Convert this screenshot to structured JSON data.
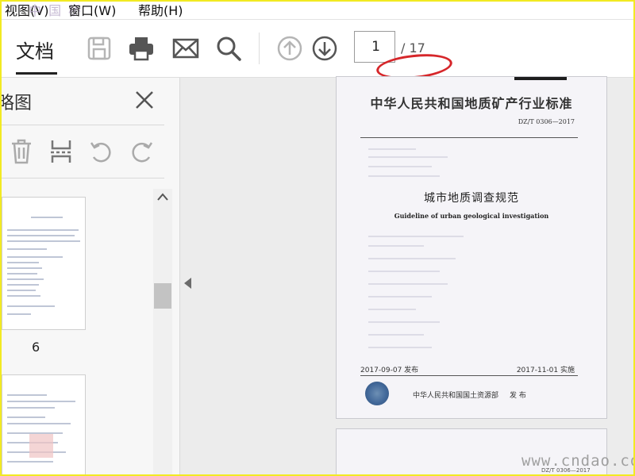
{
  "menu": {
    "view": "视图(V)",
    "window": "窗口(W)",
    "help": "帮助(H)",
    "overlay_watermark": "中 国 桥"
  },
  "toolbar": {
    "tab_document": "文档",
    "icons": [
      "save-icon",
      "print-icon",
      "mail-icon",
      "search-icon",
      "page-up-icon",
      "page-down-icon"
    ],
    "page_current": "1",
    "page_total": "/ 17"
  },
  "sidebar": {
    "title": "略图",
    "tools": [
      "delete-icon",
      "extract-icon",
      "rotate-ccw-icon",
      "rotate-cw-icon"
    ],
    "thumbnails": [
      {
        "label": "6"
      },
      {
        "label": ""
      }
    ]
  },
  "document": {
    "standard_title": "中华人民共和国地质矿产行业标准",
    "standard_code": "DZ/T 0306—2017",
    "title_cn": "城市地质调查规范",
    "title_en": "Guideline of urban geological investigation",
    "issue_date": "2017-09-07 发布",
    "effective_date": "2017-11-01 实施",
    "publisher": "中华人民共和国国土资源部",
    "publish_word": "发 布",
    "page2_code": "DZ/T 0306—2017"
  },
  "watermark": "www.cndao.com",
  "colors": {
    "annotation_red": "#d6262a",
    "frame_yellow": "#f2ea22"
  }
}
